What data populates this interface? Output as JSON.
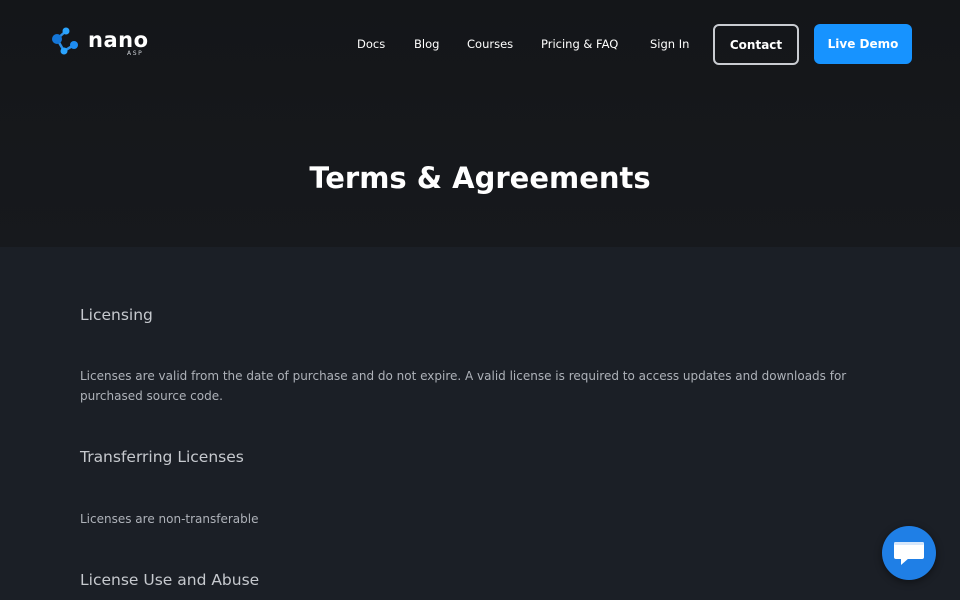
{
  "brand": {
    "name": "nano",
    "sub": "ASP"
  },
  "nav": {
    "items": [
      {
        "label": "Docs"
      },
      {
        "label": "Blog"
      },
      {
        "label": "Courses"
      },
      {
        "label": "Pricing & FAQ"
      },
      {
        "label": "Sign In"
      }
    ],
    "contact_label": "Contact",
    "demo_label": "Live Demo"
  },
  "page": {
    "title": "Terms & Agreements"
  },
  "sections": [
    {
      "heading": "Licensing",
      "body": "Licenses are valid from the date of purchase and do not expire. A valid license is required to access updates and downloads for purchased source code."
    },
    {
      "heading": "Transferring Licenses",
      "body": "Licenses are non-transferable"
    },
    {
      "heading": "License Use and Abuse"
    }
  ],
  "icons": {
    "logo": "nano-logo-icon",
    "chat": "chat-bubble-icon"
  },
  "colors": {
    "hero_bg": "#141619",
    "content_bg": "#1b1f26",
    "accent": "#1793ff",
    "chat_button": "#1f7fe6"
  }
}
